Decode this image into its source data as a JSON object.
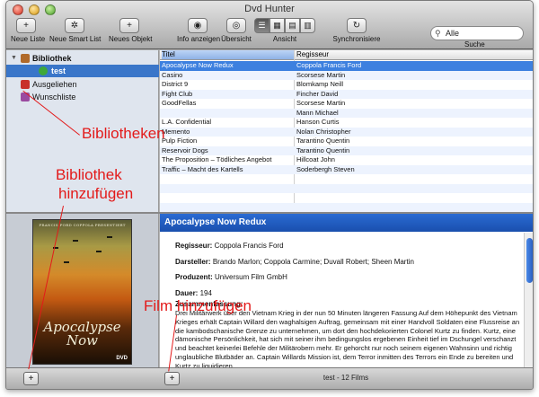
{
  "window": {
    "title": "Dvd Hunter"
  },
  "toolbar": {
    "new_list": "Neue Liste",
    "new_smart_list": "Neue Smart List",
    "new_object": "Neues Objekt",
    "show_info": "Info anzeigen",
    "overview": "Übersicht",
    "view": "Ansicht",
    "sync": "Synchronisiere",
    "search_placeholder": "Alle",
    "search_label": "Suche"
  },
  "sidebar": {
    "items": [
      {
        "label": "Bibliothek",
        "icon": "library-icon",
        "color": "#b06a2a"
      },
      {
        "label": "test",
        "icon": "green-list-icon",
        "color": "#3ea83a"
      },
      {
        "label": "Ausgeliehen",
        "icon": "borrowed-icon",
        "color": "#c8302a"
      },
      {
        "label": "Wunschliste",
        "icon": "wishlist-icon",
        "color": "#9a4aa0"
      }
    ]
  },
  "list": {
    "columns": [
      "Titel",
      "Regisseur"
    ],
    "rows": [
      [
        "Apocalypse Now Redux",
        "Coppola Francis Ford"
      ],
      [
        "Casino",
        "Scorsese Martin"
      ],
      [
        "District 9",
        "Blomkamp Neill"
      ],
      [
        "Fight Club",
        "Fincher David"
      ],
      [
        "GoodFellas",
        "Scorsese Martin"
      ],
      [
        "",
        "Mann Michael"
      ],
      [
        "L.A. Confidential",
        "Hanson Curtis"
      ],
      [
        "Memento",
        "Nolan Christopher"
      ],
      [
        "Pulp Fiction",
        "Tarantino Quentin"
      ],
      [
        "Reservoir Dogs",
        "Tarantino Quentin"
      ],
      [
        "The Proposition – Tödliches Angebot",
        "Hillcoat John"
      ],
      [
        "Traffic – Macht des Kartells",
        "Soderbergh Steven"
      ]
    ]
  },
  "poster": {
    "credit": "FRANCIS FORD COPPOLA PRESENTIERT",
    "title": "Apocalypse Now",
    "badge": "DVD"
  },
  "detail": {
    "title": "Apocalypse Now Redux",
    "director_label": "Regisseur:",
    "director": "Coppola Francis Ford",
    "cast_label": "Darsteller:",
    "cast": "Brando Marlon; Coppola Carmine; Duvall Robert; Sheen Martin",
    "producer_label": "Produzent:",
    "producer": "Universum Film GmbH",
    "duration_label": "Dauer:",
    "duration": "194",
    "summary_label": "Zusammenfassung:",
    "summary": "Drei Militärwerk über den Vietnam Krieg in der nun 50 Minuten längeren Fassung Auf dem Höhepunkt des Vietnam Krieges erhält Captain Willard den waghalsigen Auftrag, gemeinsam mit einer Handvoll Soldaten eine Flussreise an die kambodschanische Grenze zu unternehmen, um dort den hochdekorierten Colonel Kurtz zu finden. Kurtz, eine dämonische Persönlichkeit, hat sich mit seiner ihm bedingungslos ergebenen Einheit tief im Dschungel verschanzt und beachtet keinerlei Befehle der Militärobern mehr. Er gehorcht nur noch seinem eigenen Wahnsinn und richtig unglaubliche Blutbäder an. Captain Willards Mission ist, dem Terror inmitten des Terrors ein Ende zu bereiten und Kurtz zu liquidieren."
  },
  "bottom": {
    "add_symbol": "+",
    "status": "test - 12 Films"
  },
  "annotations": {
    "libraries": "Bibliotheken",
    "add_library_1": "Bibliothek",
    "add_library_2": "hinzufügen",
    "add_film": "Film hinzufügen",
    "color": "#e31a1a"
  }
}
